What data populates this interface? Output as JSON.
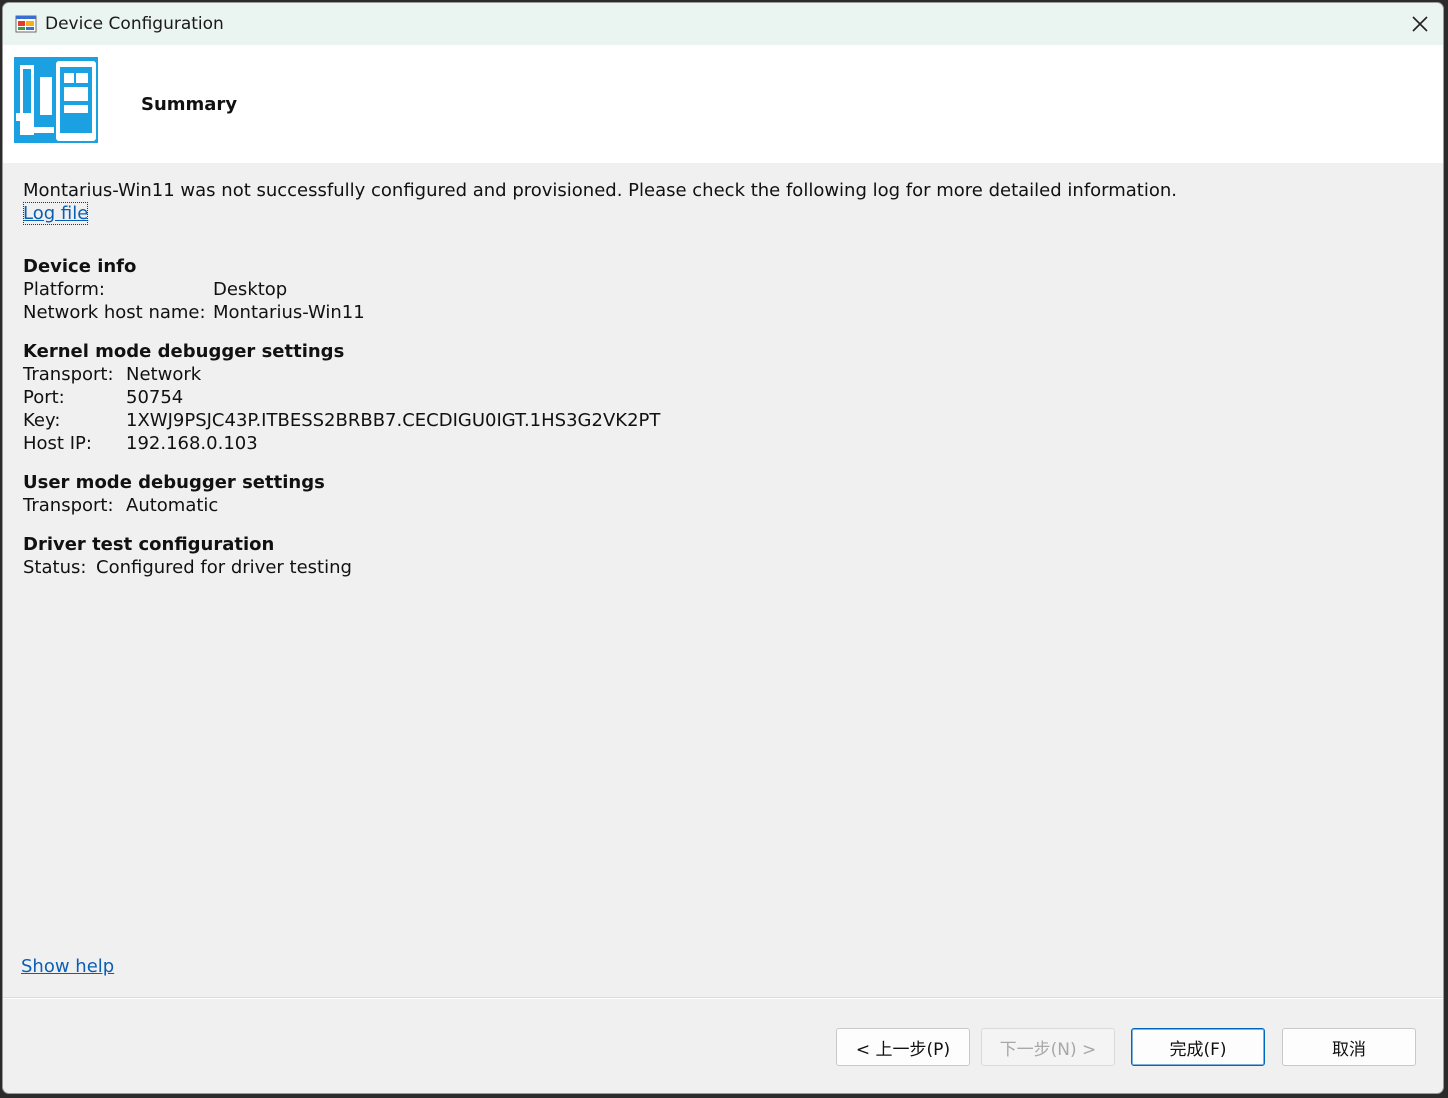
{
  "window": {
    "title": "Device Configuration"
  },
  "header": {
    "title": "Summary"
  },
  "content": {
    "message": "Montarius-Win11 was not successfully configured and provisioned. Please check the following log for more detailed information.",
    "log_link": "Log file",
    "device_info": {
      "title": "Device info",
      "platform_label": "Platform:",
      "platform_value": "Desktop",
      "host_label": "Network host name:",
      "host_value": "Montarius-Win11"
    },
    "kernel": {
      "title": "Kernel mode debugger settings",
      "transport_label": "Transport:",
      "transport_value": "Network",
      "port_label": "Port:",
      "port_value": "50754",
      "key_label": "Key:",
      "key_value": "1XWJ9PSJC43P.ITBESS2BRBB7.CECDIGU0IGT.1HS3G2VK2PT",
      "hostip_label": "Host IP:",
      "hostip_value": "192.168.0.103"
    },
    "user_mode": {
      "title": "User mode debugger settings",
      "transport_label": "Transport:",
      "transport_value": "Automatic"
    },
    "driver_test": {
      "title": "Driver test configuration",
      "status_label": "Status:",
      "status_value": "Configured for driver testing"
    },
    "show_help": "Show help"
  },
  "buttons": {
    "back": "< 上一步(P)",
    "next": "下一步(N) >",
    "finish": "完成(F)",
    "cancel": "取消"
  },
  "colors": {
    "accent": "#1ba1e2",
    "link": "#0a5fb4"
  }
}
